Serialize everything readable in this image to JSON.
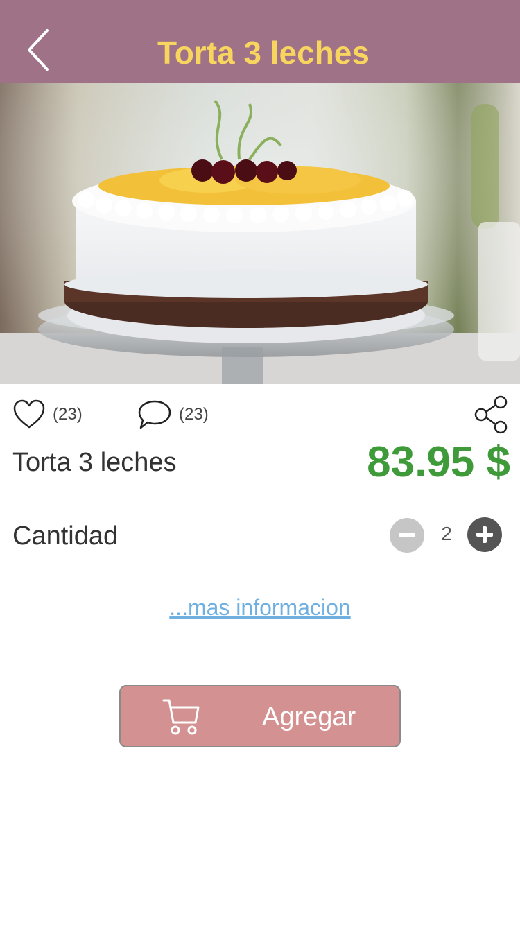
{
  "header": {
    "title": "Torta 3 leches",
    "back_icon": "chevron-left-icon",
    "background_color": "#a07287",
    "title_color": "#f8d55e"
  },
  "hero_image": {
    "subject": "cake-photo"
  },
  "actions": {
    "likes_count": "(23)",
    "comments_count": "(23)",
    "like_icon": "heart-icon",
    "comment_icon": "speech-bubble-icon",
    "share_icon": "share-icon"
  },
  "product": {
    "name": "Torta 3 leches",
    "price": "83.95 $",
    "price_color": "#3f9a3a"
  },
  "quantity": {
    "label": "Cantidad",
    "value": "2",
    "minus_icon": "minus-icon",
    "plus_icon": "plus-icon"
  },
  "more_info": {
    "label": "...mas informacion",
    "color": "#6fb0e0"
  },
  "add_button": {
    "label": "Agregar",
    "icon": "cart-icon",
    "color": "#d39192"
  }
}
